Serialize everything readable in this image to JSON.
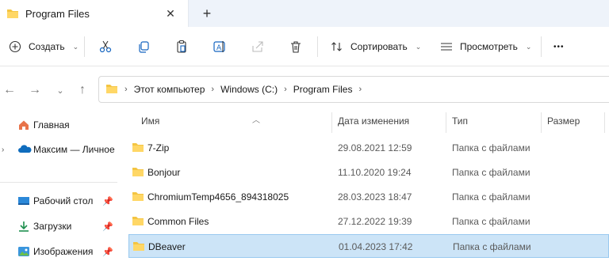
{
  "window": {
    "tab_title": "Program Files",
    "new_tab_label": "+",
    "close_label": "✕"
  },
  "toolbar": {
    "create_label": "Создать",
    "sort_label": "Сортировать",
    "view_label": "Просмотреть",
    "more_label": "•••"
  },
  "address": {
    "breadcrumbs": [
      "Этот компьютер",
      "Windows (C:)",
      "Program Files"
    ]
  },
  "sidebar": {
    "items": [
      {
        "label": "Главная",
        "icon": "home-icon"
      },
      {
        "label": "Максим — Личное",
        "icon": "onedrive-icon"
      },
      {
        "label": "Рабочий стол",
        "icon": "desktop-icon"
      },
      {
        "label": "Загрузки",
        "icon": "download-icon"
      },
      {
        "label": "Изображения",
        "icon": "pictures-icon"
      }
    ]
  },
  "filelist": {
    "columns": [
      "Имя",
      "Дата изменения",
      "Тип",
      "Размер"
    ],
    "rows": [
      {
        "name": "7-Zip",
        "date": "29.08.2021 12:59",
        "type": "Папка с файлами"
      },
      {
        "name": "Bonjour",
        "date": "11.10.2020 19:24",
        "type": "Папка с файлами"
      },
      {
        "name": "ChromiumTemp4656_894318025",
        "date": "28.03.2023 18:47",
        "type": "Папка с файлами"
      },
      {
        "name": "Common Files",
        "date": "27.12.2022 19:39",
        "type": "Папка с файлами"
      },
      {
        "name": "DBeaver",
        "date": "01.04.2023 17:42",
        "type": "Папка с файлами",
        "selected": true
      }
    ]
  },
  "colors": {
    "folder": "#f4c542",
    "selection": "#cce4f7",
    "accent": "#0067c0"
  }
}
